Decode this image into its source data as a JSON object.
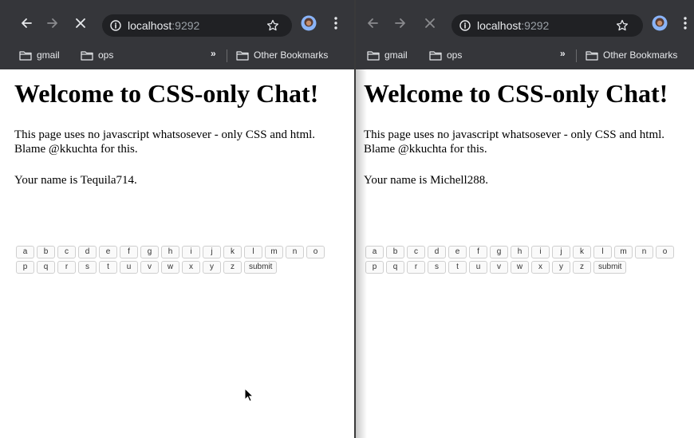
{
  "windows": [
    {
      "url_host": "localhost",
      "url_port": ":9292",
      "bookmarks": [
        "gmail",
        "ops"
      ],
      "bookmark_overflow": "»",
      "other_bookmarks": "Other Bookmarks",
      "page": {
        "title": "Welcome to CSS-only Chat!",
        "intro": "This page uses no javascript whatsosever - only CSS and html. Blame @kkuchta for this.",
        "name_line": "Your name is Tequila714."
      },
      "keyboard": {
        "row1": [
          "a",
          "b",
          "c",
          "d",
          "e",
          "f",
          "g",
          "h",
          "i",
          "j",
          "k",
          "l",
          "m",
          "n",
          "o"
        ],
        "row2": [
          "p",
          "q",
          "r",
          "s",
          "t",
          "u",
          "v",
          "w",
          "x",
          "y",
          "z"
        ],
        "submit": "submit"
      }
    },
    {
      "url_host": "localhost",
      "url_port": ":9292",
      "bookmarks": [
        "gmail",
        "ops"
      ],
      "bookmark_overflow": "»",
      "other_bookmarks": "Other Bookmarks",
      "page": {
        "title": "Welcome to CSS-only Chat!",
        "intro": "This page uses no javascript whatsosever - only CSS and html. Blame @kkuchta for this.",
        "name_line": "Your name is Michell288."
      },
      "keyboard": {
        "row1": [
          "a",
          "b",
          "c",
          "d",
          "e",
          "f",
          "g",
          "h",
          "i",
          "j",
          "k",
          "l",
          "m",
          "n",
          "o"
        ],
        "row2": [
          "p",
          "q",
          "r",
          "s",
          "t",
          "u",
          "v",
          "w",
          "x",
          "y",
          "z"
        ],
        "submit": "submit"
      }
    }
  ],
  "icons": {
    "back": "back-arrow-icon",
    "forward": "forward-arrow-icon",
    "stop": "stop-loading-icon",
    "info": "site-info-icon",
    "star": "bookmark-star-icon",
    "avatar": "profile-avatar-icon",
    "menu": "more-menu-icon",
    "folder": "folder-icon",
    "cursor": "mouse-pointer-icon"
  },
  "colors": {
    "toolbar": "#35363a",
    "omnibox": "#202124",
    "page_background": "#ffffff"
  }
}
